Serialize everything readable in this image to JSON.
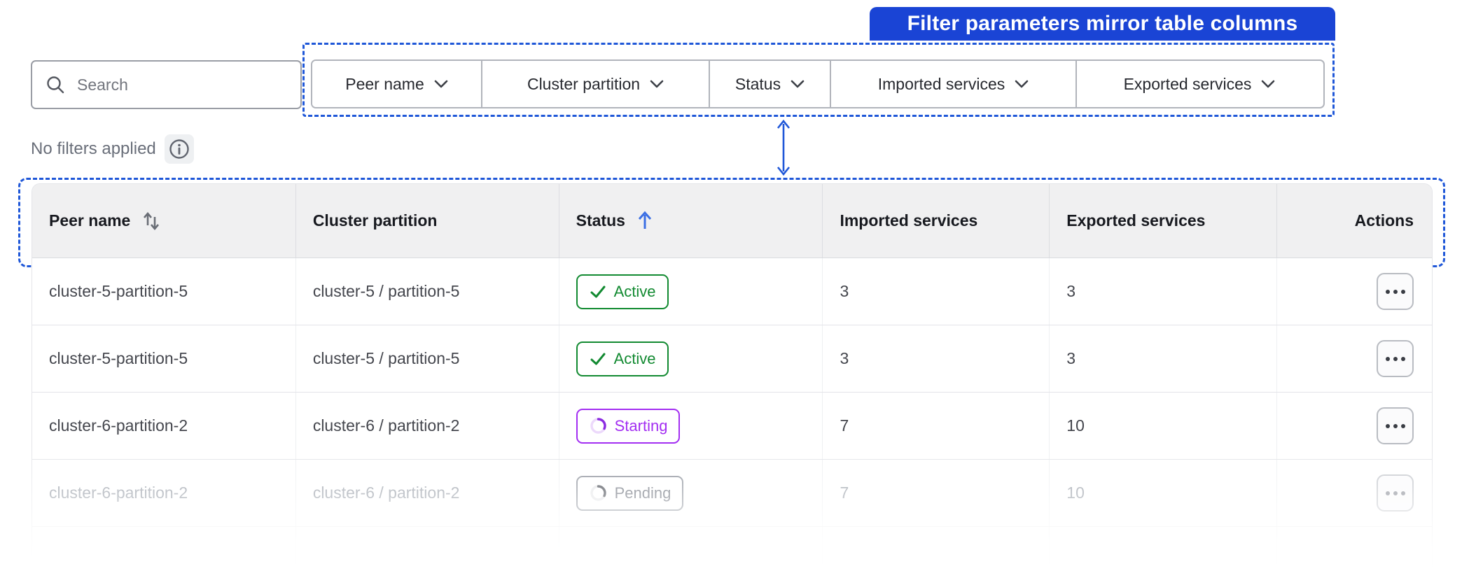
{
  "annotation": {
    "banner_label": "Filter parameters mirror table columns",
    "accent_color": "#1a44d5",
    "dashed_border_color": "#1f57d8"
  },
  "toolbar": {
    "search": {
      "placeholder": "Search"
    },
    "filters": [
      {
        "label": "Peer name"
      },
      {
        "label": "Cluster partition"
      },
      {
        "label": "Status"
      },
      {
        "label": "Imported services"
      },
      {
        "label": "Exported services"
      }
    ],
    "note": "No filters applied"
  },
  "table": {
    "columns": [
      {
        "label": "Peer name",
        "sort": "sortable"
      },
      {
        "label": "Cluster partition",
        "sort": "none"
      },
      {
        "label": "Status",
        "sort": "asc"
      },
      {
        "label": "Imported services",
        "sort": "none"
      },
      {
        "label": "Exported services",
        "sort": "none"
      },
      {
        "label": "Actions",
        "sort": "none"
      }
    ],
    "rows": [
      {
        "peer_name": "cluster-5-partition-5",
        "cluster_partition": "cluster-5 / partition-5",
        "status": "Active",
        "status_kind": "success",
        "imported_services": "3",
        "exported_services": "3"
      },
      {
        "peer_name": "cluster-5-partition-5",
        "cluster_partition": "cluster-5 / partition-5",
        "status": "Active",
        "status_kind": "success",
        "imported_services": "3",
        "exported_services": "3"
      },
      {
        "peer_name": "cluster-6-partition-2",
        "cluster_partition": "cluster-6 / partition-2",
        "status": "Starting",
        "status_kind": "progress",
        "imported_services": "7",
        "exported_services": "10"
      },
      {
        "peer_name": "cluster-6-partition-2",
        "cluster_partition": "cluster-6 / partition-2",
        "status": "Pending",
        "status_kind": "neutral",
        "imported_services": "7",
        "exported_services": "10"
      }
    ]
  },
  "status_colors": {
    "active_green": "#128a31",
    "starting_purple": "#a32ef2",
    "pending_gray": "#8f949d",
    "sort_asc_blue": "#3b6fe4"
  },
  "icons": {
    "search-icon": "⌕",
    "chevron-down-icon": "⌄",
    "info-icon": "ⓘ",
    "sort-icon": "⇅",
    "sort-asc-icon": "↑",
    "check-icon": "✓",
    "spinner-icon": "◔",
    "ellipsis-icon": "⋯",
    "double-arrow-icon": "↕"
  }
}
